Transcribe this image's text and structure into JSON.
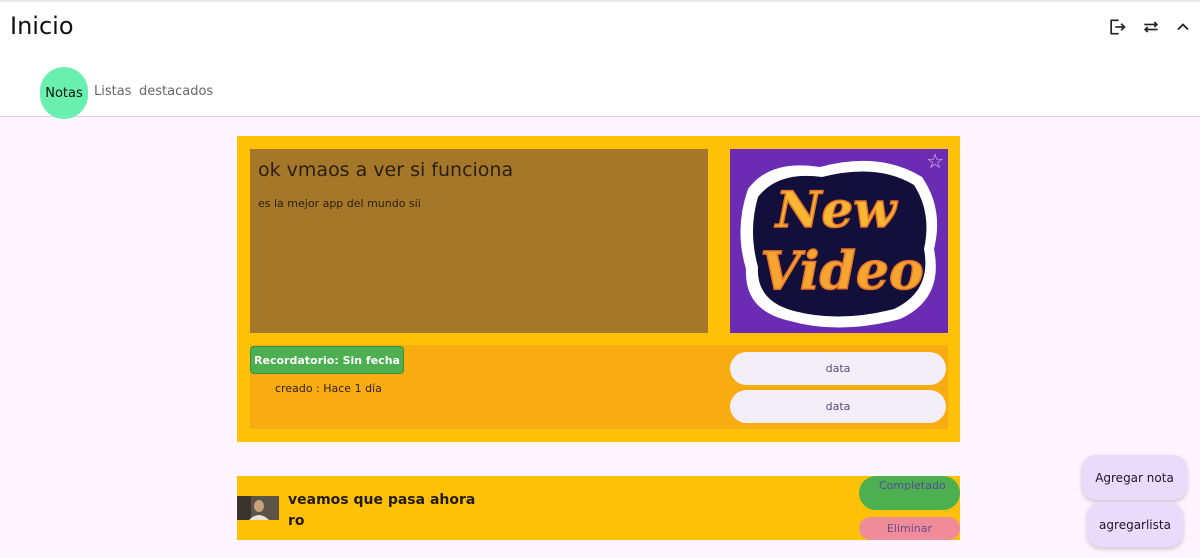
{
  "header": {
    "title": "Inicio",
    "icons": [
      "logout-icon",
      "swap-icon",
      "chevron-up-icon"
    ]
  },
  "tabs": {
    "notas": "Notas",
    "listas": "Listas",
    "destacados": "destacados"
  },
  "note_card": {
    "title": "ok vmaos a ver si funciona",
    "description": "es la mejor app del mundo sii",
    "image_text_top": "New",
    "image_text_bottom": "Video",
    "reminder_label": "Recordatorio: Sin fecha",
    "created_label": "creado : Hace 1 día",
    "data_button_1": "data",
    "data_button_2": "data"
  },
  "list_card": {
    "title": "veamos que pasa ahora ro",
    "completed_label": "Completado",
    "delete_label": "Eliminar"
  },
  "fabs": {
    "add_note": "Agregar nota",
    "add_list": "agregarlista"
  },
  "colors": {
    "background": "#fcf5ff",
    "card": "#ffc107",
    "note_body": "#a57729",
    "active_tab": "#69f0ae",
    "green": "#4caf50",
    "delete": "#f08c9a",
    "fab": "#e9dcfa"
  }
}
